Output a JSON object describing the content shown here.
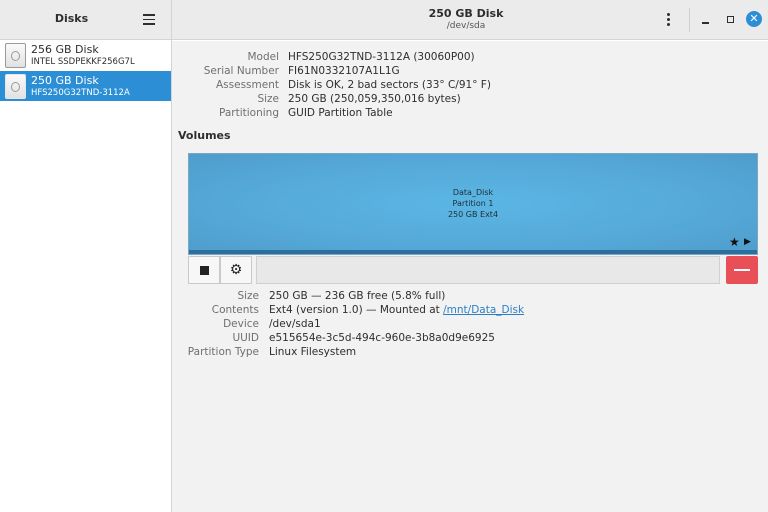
{
  "sidebar": {
    "title": "Disks",
    "disks": [
      {
        "name": "256 GB Disk",
        "model": "INTEL SSDPEKKF256G7L"
      },
      {
        "name": "250 GB Disk",
        "model": "HFS250G32TND-3112A"
      }
    ]
  },
  "header": {
    "title": "250 GB Disk",
    "subtitle": "/dev/sda"
  },
  "disk_info": {
    "model_label": "Model",
    "model": "HFS250G32TND-3112A (30060P00)",
    "serial_label": "Serial Number",
    "serial": "FI61N0332107A1L1G",
    "assessment_label": "Assessment",
    "assessment": "Disk is OK, 2 bad sectors (33° C/91° F)",
    "size_label": "Size",
    "size": "250 GB (250,059,350,016 bytes)",
    "partitioning_label": "Partitioning",
    "partitioning": "GUID Partition Table"
  },
  "volumes": {
    "title": "Volumes",
    "partition": {
      "name": "Data_Disk",
      "number": "Partition 1",
      "desc": "250 GB Ext4"
    }
  },
  "volume_info": {
    "size_label": "Size",
    "size": "250 GB — 236 GB free (5.8% full)",
    "contents_label": "Contents",
    "contents_prefix": "Ext4 (version 1.0) — Mounted at",
    "mount_link": "/mnt/Data_Disk",
    "device_label": "Device",
    "device": "/dev/sda1",
    "uuid_label": "UUID",
    "uuid": "e515654e-3c5d-494c-960e-3b8a0d9e6925",
    "ptype_label": "Partition Type",
    "ptype": "Linux Filesystem"
  },
  "icons": {
    "menu": "hamburger-icon",
    "kebab": "vertical-dots-icon",
    "star": "star-icon",
    "play": "play-icon",
    "stop": "stop-icon",
    "settings": "gear-icon",
    "delete": "minus-icon"
  },
  "colors": {
    "selection": "#2c8fd6",
    "partition_fill": "#55aad9",
    "delete_button": "#e94f57",
    "close_button": "#2c8fd6"
  }
}
